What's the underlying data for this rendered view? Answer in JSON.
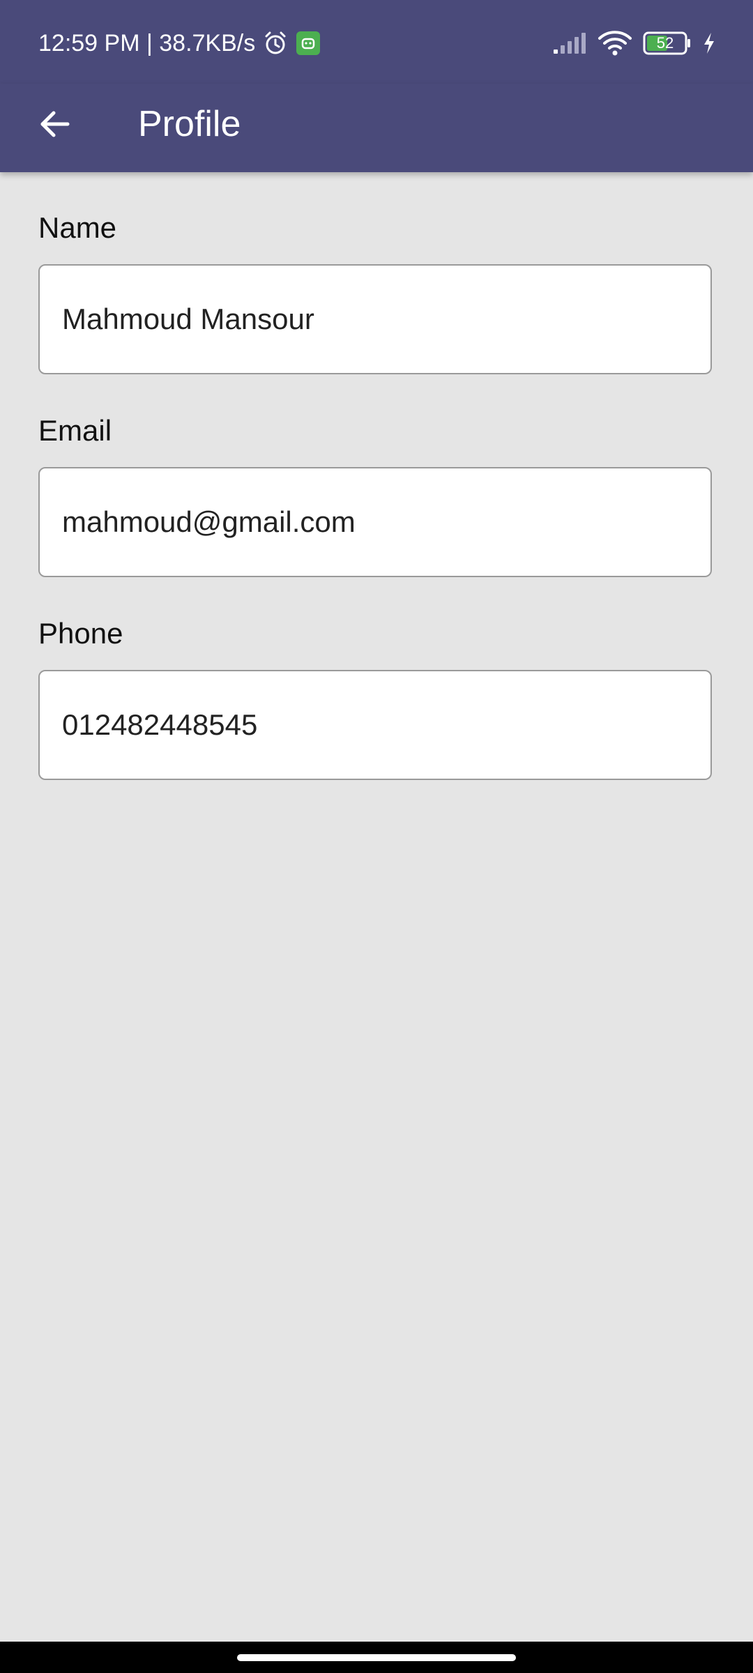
{
  "status_bar": {
    "left_text": "12:59 PM | 38.7KB/s",
    "battery_level": "52",
    "colors": {
      "background": "#4a4a7a",
      "app_badge": "#4caf50"
    },
    "icons": [
      "alarm-icon",
      "app-notification-icon",
      "signal-icon",
      "wifi-icon",
      "battery-icon",
      "charging-icon"
    ]
  },
  "app_bar": {
    "title": "Profile",
    "back_icon": "arrow-left-icon",
    "background": "#4a4a7a"
  },
  "form": {
    "name": {
      "label": "Name",
      "value": "Mahmoud Mansour"
    },
    "email": {
      "label": "Email",
      "value": "mahmoud@gmail.com"
    },
    "phone": {
      "label": "Phone",
      "value": "012482448545"
    }
  }
}
